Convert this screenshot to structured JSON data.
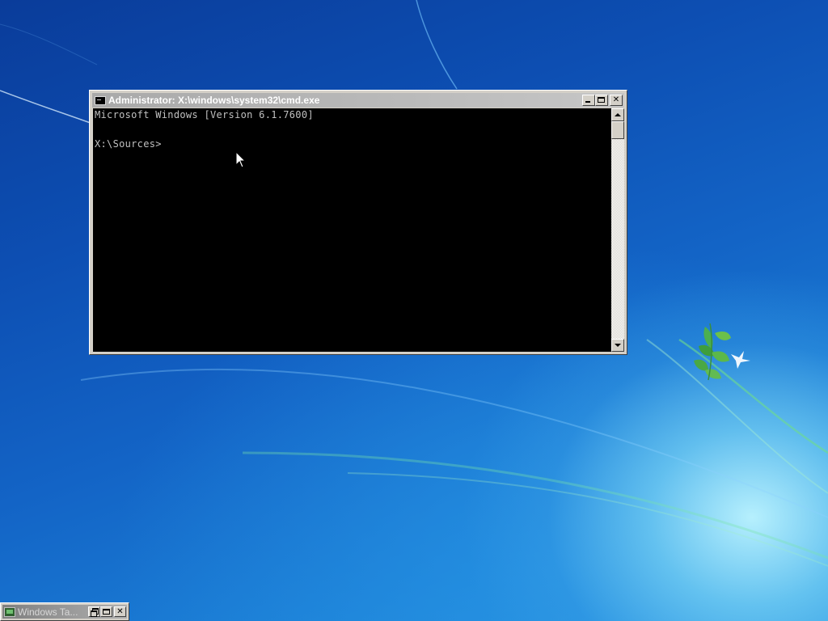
{
  "window": {
    "title": "Administrator: X:\\windows\\system32\\cmd.exe",
    "icon": "console-icon"
  },
  "console": {
    "lines": [
      "Microsoft Windows [Version 6.1.7600]",
      "",
      "X:\\Sources>"
    ]
  },
  "minimized_window": {
    "title": "Windows Ta...",
    "icon": "task-window-icon"
  },
  "colors": {
    "console_background": "#000000",
    "console_text": "#c0c0c0",
    "title_bar": "#a9a9a9",
    "desktop_blue": "#0d4fb3"
  }
}
